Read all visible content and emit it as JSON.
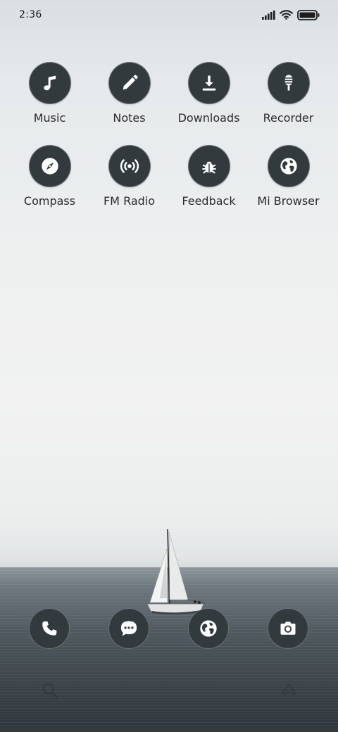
{
  "status_bar": {
    "time": "2:36",
    "icons": [
      "signal-icon",
      "wifi-icon",
      "battery-icon"
    ]
  },
  "apps": [
    {
      "label": "Music",
      "icon": "music-note-icon"
    },
    {
      "label": "Notes",
      "icon": "pencil-icon"
    },
    {
      "label": "Downloads",
      "icon": "download-icon"
    },
    {
      "label": "Recorder",
      "icon": "microphone-icon"
    },
    {
      "label": "Compass",
      "icon": "compass-icon"
    },
    {
      "label": "FM Radio",
      "icon": "radio-broadcast-icon"
    },
    {
      "label": "Feedback",
      "icon": "bug-icon"
    },
    {
      "label": "Mi Browser",
      "icon": "globe-icon"
    }
  ],
  "dock": [
    {
      "icon": "phone-icon"
    },
    {
      "icon": "message-icon"
    },
    {
      "icon": "globe-icon"
    },
    {
      "icon": "camera-icon"
    }
  ],
  "colors": {
    "icon_bg": "#333a3d",
    "icon_fg": "#ffffff",
    "label_text": "#2b2b2b"
  }
}
